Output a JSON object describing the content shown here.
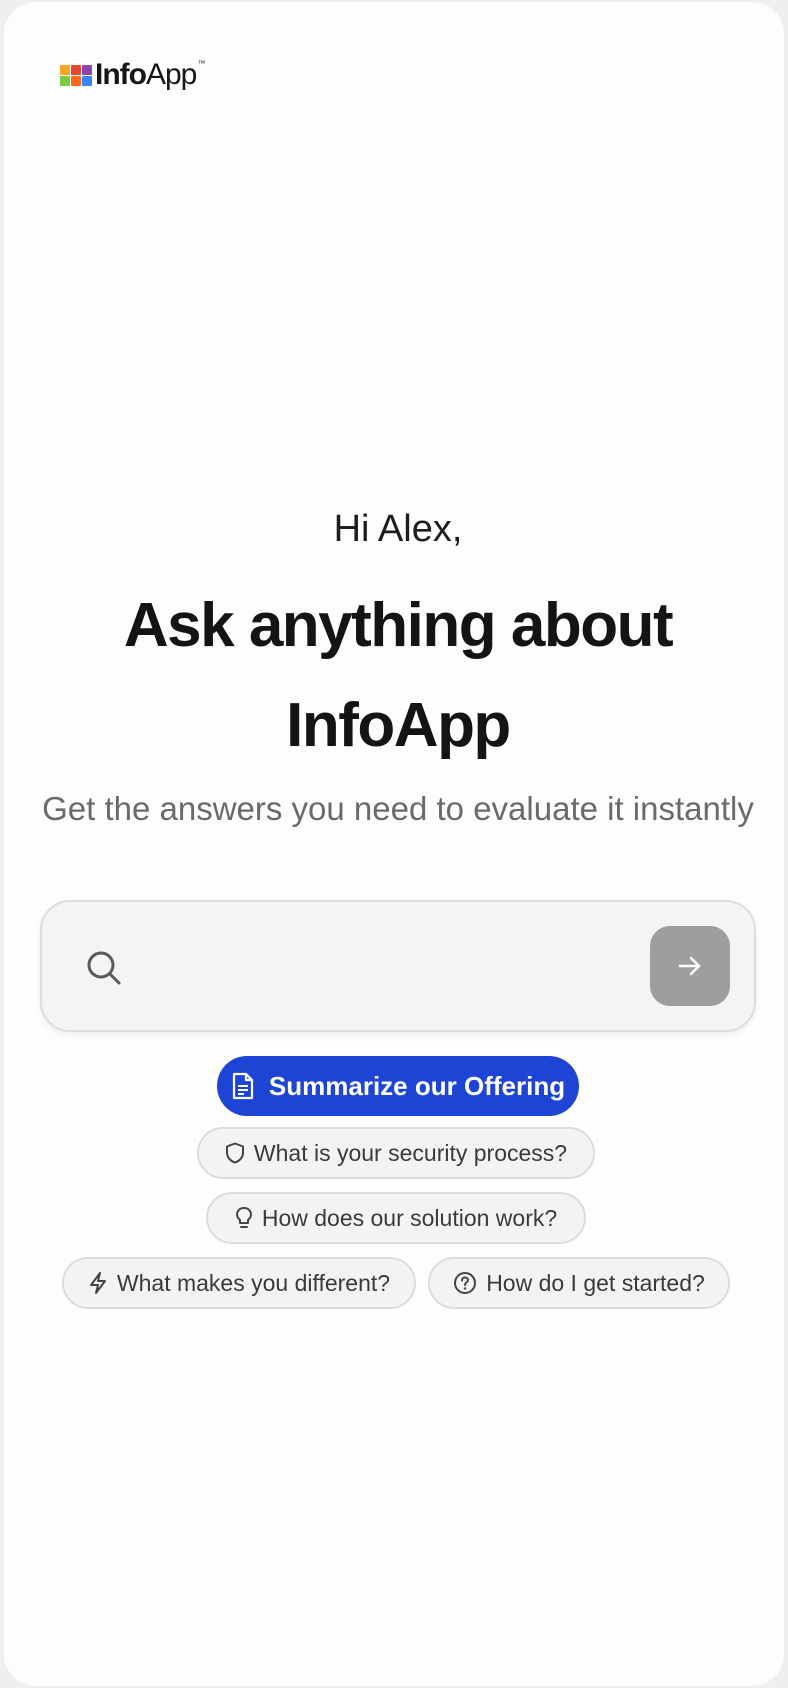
{
  "logo": {
    "text_bold": "Info",
    "text_light": "App",
    "trademark": "™",
    "colors": [
      "#f5a623",
      "#e6452f",
      "#8e44ad",
      "#7ac943",
      "#ff6a1a",
      "#3b82f6"
    ]
  },
  "hero": {
    "greeting": "Hi Alex,",
    "headline": "Ask anything about InfoApp",
    "subtitle": "Get the answers you need to evaluate it instantly"
  },
  "search": {
    "placeholder": "",
    "value": "",
    "icon": "search-icon",
    "send_icon": "arrow-right-icon"
  },
  "suggestions": {
    "primary": {
      "label": "Summarize our Offering",
      "icon": "document-icon",
      "color": "#1d44d4"
    },
    "items": [
      {
        "label": "What is your security process?",
        "icon": "shield-icon"
      },
      {
        "label": "How does our solution work?",
        "icon": "lightbulb-icon"
      },
      {
        "label": "What makes you different?",
        "icon": "lightning-icon"
      },
      {
        "label": "How do I get started?",
        "icon": "help-circle-icon"
      }
    ]
  }
}
